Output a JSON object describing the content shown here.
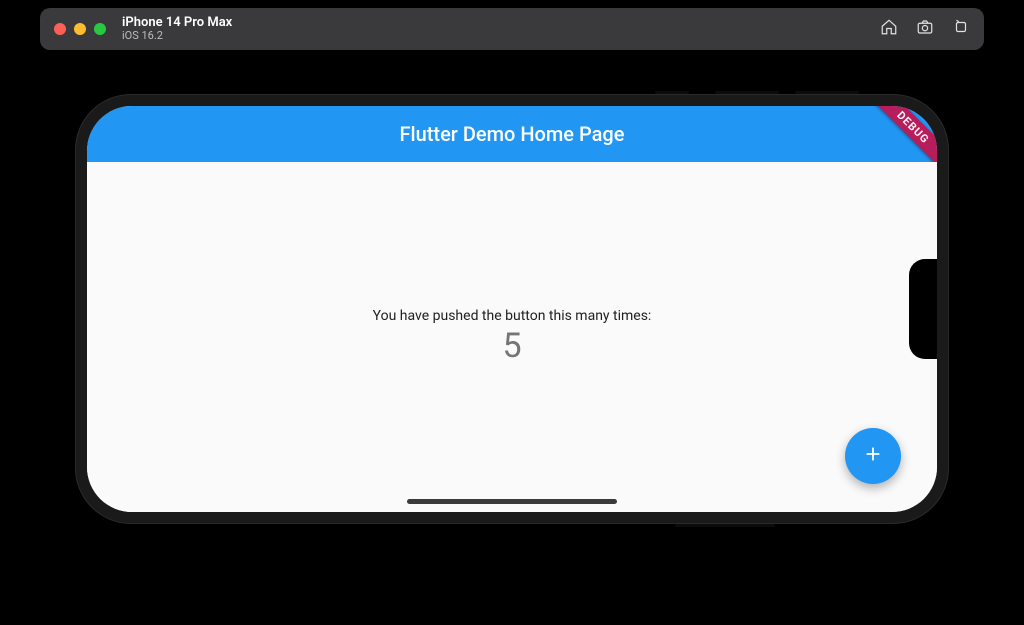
{
  "simulator": {
    "device_name": "iPhone 14 Pro Max",
    "os_version": "iOS 16.2",
    "actions": {
      "home": "Home",
      "screenshot": "Screenshot",
      "rotate": "Rotate"
    }
  },
  "app": {
    "appbar_title": "Flutter Demo Home Page",
    "body_text": "You have pushed the button this many times:",
    "counter_value": "5",
    "fab_tooltip": "Increment",
    "debug_banner": "DEBUG",
    "colors": {
      "primary": "#2196f3",
      "scaffold_bg": "#fafafa",
      "debug_banner": "#b71c5b"
    }
  }
}
